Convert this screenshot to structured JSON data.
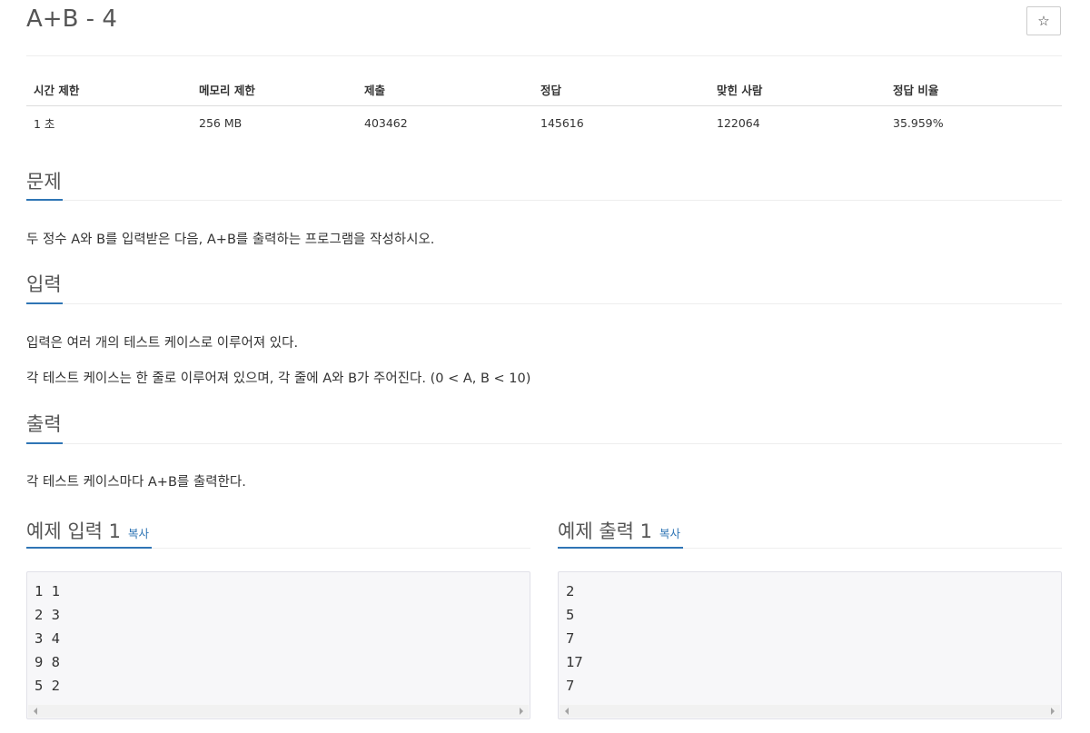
{
  "problem": {
    "title": "A+B - 4",
    "star_icon": "☆"
  },
  "stats": {
    "headers": [
      "시간 제한",
      "메모리 제한",
      "제출",
      "정답",
      "맞힌 사람",
      "정답 비율"
    ],
    "values": [
      "1 초",
      "256 MB",
      "403462",
      "145616",
      "122064",
      "35.959%"
    ]
  },
  "sections": {
    "description": {
      "title": "문제",
      "paragraphs": [
        "두 정수 A와 B를 입력받은 다음, A+B를 출력하는 프로그램을 작성하시오."
      ]
    },
    "input": {
      "title": "입력",
      "paragraphs": [
        "입력은 여러 개의 테스트 케이스로 이루어져 있다.",
        "각 테스트 케이스는 한 줄로 이루어져 있으며, 각 줄에 A와 B가 주어진다. (0 < A, B < 10)"
      ]
    },
    "output": {
      "title": "출력",
      "paragraphs": [
        "각 테스트 케이스마다 A+B를 출력한다."
      ]
    }
  },
  "samples": {
    "input": {
      "title": "예제 입력 1",
      "copy_label": "복사",
      "lines": [
        "1 1",
        "2 3",
        "3 4",
        "9 8",
        "5 2"
      ]
    },
    "output": {
      "title": "예제 출력 1",
      "copy_label": "복사",
      "lines": [
        "2",
        "5",
        "7",
        "17",
        "7"
      ]
    }
  },
  "colors": {
    "accent": "#2f75b5",
    "pre_background": "#f7f7f9",
    "pre_border": "#e1e1e8"
  }
}
